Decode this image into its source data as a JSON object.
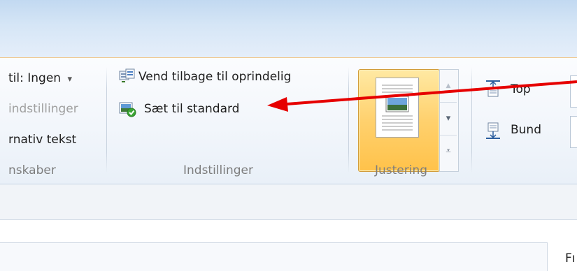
{
  "ribbon": {
    "left_partial": {
      "alt_dropdown": "til: Ingen",
      "alt_dropdown_arrow": "▾",
      "settings_disabled": "indstillinger",
      "alt_text": "rnativ tekst",
      "group_label": "nskaber"
    },
    "settings_group": {
      "reset_original": "Vend tilbage til oprindelig",
      "set_default": "Sæt til standard",
      "group_label": "Indstillinger"
    },
    "alignment_group": {
      "group_label": "Justering",
      "scroll_up": "▲",
      "scroll_down": "▾",
      "scroll_more": "⩡"
    },
    "margins": {
      "top_label": "Top",
      "bottom_label": "Bund"
    }
  },
  "document": {
    "tab_partial": "Fı"
  },
  "annotation": {
    "arrow_color": "#e60000"
  },
  "colors": {
    "gallery_highlight": "#ffd16e",
    "ribbon_bg": "#f2f6fb"
  }
}
